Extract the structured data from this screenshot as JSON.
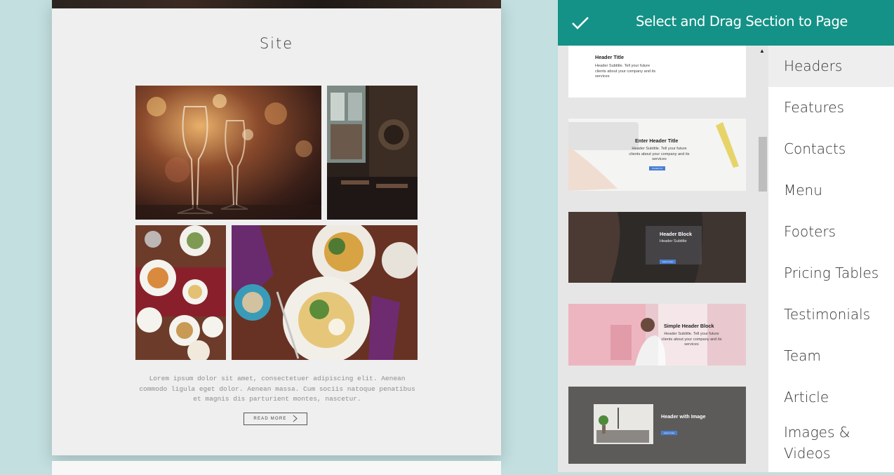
{
  "canvas": {
    "site_title": "Site",
    "lorem": "Lorem ipsum dolor sit amet, consectetuer adipiscing elit. Aenean commodo ligula eget dolor. Aenean massa. Cum sociis natoque penatibus et magnis dis parturient montes, nascetur.",
    "read_more_label": "READ MORE",
    "images": [
      "wine-glasses-photo",
      "restaurant-interior-photo",
      "table-dishes-photo",
      "salad-plates-photo"
    ]
  },
  "panel": {
    "title": "Select and Drag Section to Page",
    "confirm_icon": "checkmark-icon",
    "accent_color": "#149287",
    "thumbnails": [
      {
        "title": "Header Title",
        "subtitle": "Header Subtitle. Tell your future clients about your company and its services"
      },
      {
        "title": "Enter Header Title",
        "subtitle": "Header Subtitle. Tell your future clients about your company and its services",
        "button": "Contact Us"
      },
      {
        "title": "Header Block",
        "subtitle": "Header Subtitle",
        "button": "Learn more"
      },
      {
        "title": "Simple Header Block",
        "subtitle": "Header Subtitle. Tell your future clients about your company and its services"
      },
      {
        "title": "Header with Image",
        "button": "Learn more"
      }
    ],
    "categories": [
      {
        "label": "Headers",
        "active": true
      },
      {
        "label": "Features"
      },
      {
        "label": "Contacts"
      },
      {
        "label": "Menu"
      },
      {
        "label": "Footers"
      },
      {
        "label": "Pricing Tables"
      },
      {
        "label": "Testimonials"
      },
      {
        "label": "Team"
      },
      {
        "label": "Article"
      },
      {
        "label": "Images & Videos"
      }
    ]
  }
}
